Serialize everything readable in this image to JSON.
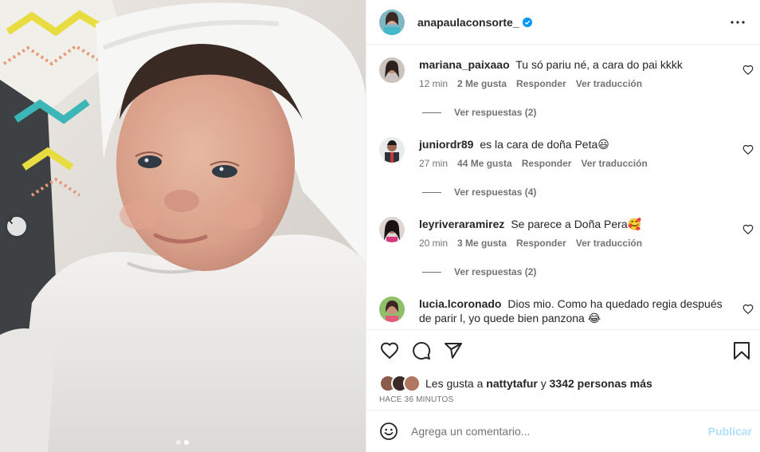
{
  "post": {
    "username": "anapaulaconsorte_",
    "verified": true,
    "carousel": {
      "dots": 2,
      "active_index": 1
    }
  },
  "comments": [
    {
      "user": "mariana_paixaao",
      "text": "Tu só pariu né, a cara do pai kkkk",
      "time": "12 min",
      "likes": "2 Me gusta",
      "reply": "Responder",
      "translate": "Ver traducción",
      "replies": "Ver respuestas (2)"
    },
    {
      "user": "juniordr89",
      "text": "es la cara de doña Peta😃",
      "time": "27 min",
      "likes": "44 Me gusta",
      "reply": "Responder",
      "translate": "Ver traducción",
      "replies": "Ver respuestas (4)"
    },
    {
      "user": "leyriveraramirez",
      "text": "Se parece a Doña Pera🥰",
      "time": "20 min",
      "likes": "3 Me gusta",
      "reply": "Responder",
      "translate": "Ver traducción",
      "replies": "Ver respuestas (2)"
    },
    {
      "user": "lucia.lcoronado",
      "text": "Dios mio. Como ha quedado regia después de parir l, yo quede bien panzona 😂",
      "time": "",
      "likes": "",
      "reply": "",
      "translate": "",
      "replies": ""
    }
  ],
  "likes": {
    "prefix": "Les gusta a",
    "first_user": "nattytafur",
    "connector": "y",
    "others": "3342 personas más"
  },
  "timestamp": "HACE 36 MINUTOS",
  "add_comment": {
    "placeholder": "Agrega un comentario...",
    "publish_label": "Publicar"
  },
  "colors": {
    "verified": "#0095f6",
    "publish_disabled": "#b2dffc",
    "secondary_text": "#737373"
  },
  "icons": [
    "chevron-left-icon",
    "verified-icon",
    "more-icon",
    "heart-icon",
    "comment-icon",
    "share-icon",
    "bookmark-icon",
    "emoji-icon"
  ]
}
